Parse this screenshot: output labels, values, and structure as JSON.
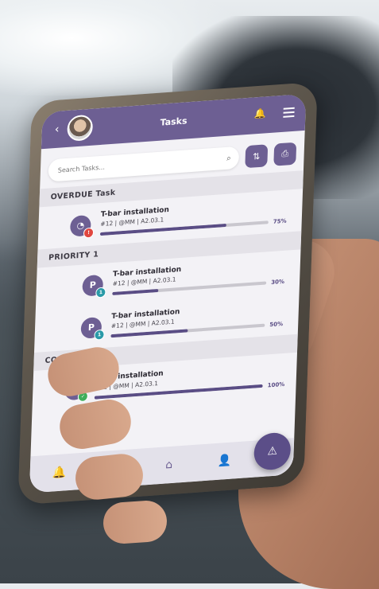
{
  "header": {
    "title": "Tasks",
    "back_icon": "chevron-left-icon",
    "bell_icon": "bell-icon",
    "menu_icon": "menu-icon"
  },
  "search": {
    "placeholder": "Search Tasks..."
  },
  "toolbar": {
    "sort_icon": "sort-icon",
    "print_icon": "printer-icon"
  },
  "sections": [
    {
      "label": "OVERDUE Task"
    },
    {
      "label": "PRIORITY 1"
    },
    {
      "label": "COMPLETED"
    }
  ],
  "tasks": [
    {
      "title": "T-bar installation",
      "meta": "#12 | @MM | A2.03.1",
      "percent_label": "75%",
      "progress": 0.75,
      "icon_letter": "",
      "badge": "!"
    },
    {
      "title": "T-bar installation",
      "meta": "#12 | @MM | A2.03.1",
      "percent_label": "30%",
      "progress": 0.3,
      "icon_letter": "P",
      "badge": "1"
    },
    {
      "title": "T-bar installation",
      "meta": "#12 | @MM | A2.03.1",
      "percent_label": "50%",
      "progress": 0.5,
      "icon_letter": "P",
      "badge": "1"
    },
    {
      "title": "T-bar installation",
      "meta": "#12 | @MM | A2.03.1",
      "percent_label": "100%",
      "progress": 1.0,
      "icon_letter": "",
      "badge": "✓"
    }
  ],
  "nav": {
    "items": [
      "bell-icon",
      "mail-icon",
      "home-icon",
      "user-icon"
    ],
    "fab_icon": "alert-icon"
  },
  "colors": {
    "accent": "#6d5f93",
    "progress": "#5a4d85",
    "overdue": "#e0463f",
    "priority": "#2a9aa8",
    "done": "#3fae5a"
  }
}
